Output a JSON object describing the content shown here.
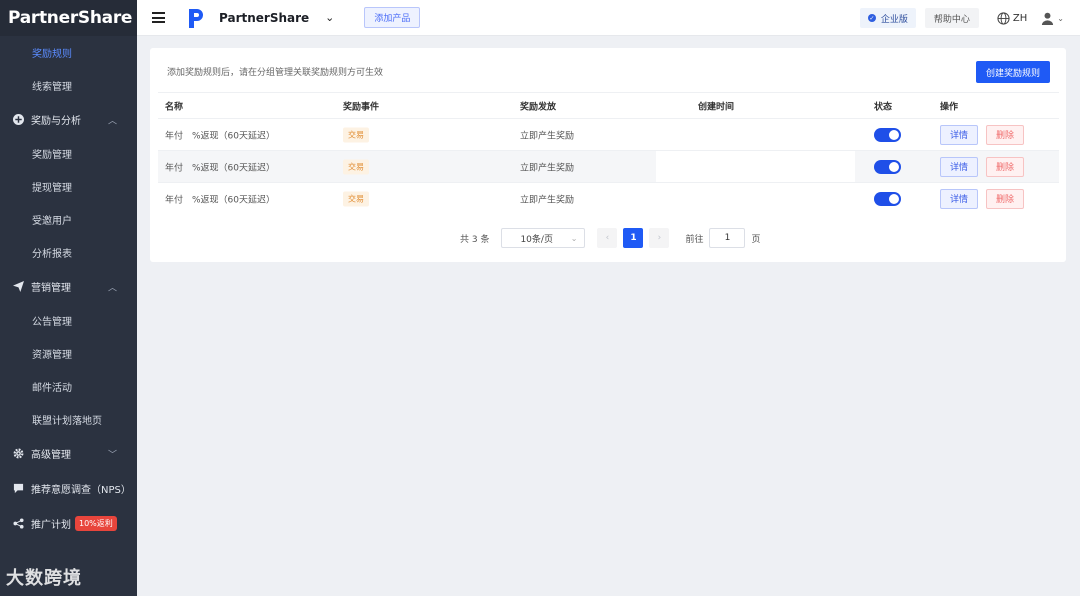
{
  "sidebar": {
    "logo": "PartnerShare",
    "top_items": [
      "奖励规则",
      "线索管理"
    ],
    "groups": [
      {
        "label": "奖励与分析",
        "icon": "plus-circle-icon",
        "chevron": "up",
        "items": [
          "奖励管理",
          "提现管理",
          "受邀用户",
          "分析报表"
        ]
      },
      {
        "label": "营销管理",
        "icon": "paper-plane-icon",
        "chevron": "up",
        "items": [
          "公告管理",
          "资源管理",
          "邮件活动",
          "联盟计划落地页"
        ]
      },
      {
        "label": "高级管理",
        "icon": "gear-icon",
        "chevron": "down",
        "items": []
      },
      {
        "label": "推荐意愿调查（NPS）",
        "icon": "chat-icon",
        "chevron": "",
        "items": []
      },
      {
        "label": "推广计划",
        "icon": "share-icon",
        "chevron": "",
        "items": [],
        "badge": "10%返利"
      }
    ],
    "watermark": "大数跨境",
    "active_item": "奖励规则"
  },
  "header": {
    "app_name": "PartnerShare",
    "add_product": "添加产品",
    "enterprise": "企业版",
    "help": "帮助中心",
    "lang": "ZH"
  },
  "main": {
    "hint": "添加奖励规则后，请在分组管理关联奖励规则方可生效",
    "create_button": "创建奖励规则",
    "columns": [
      "名称",
      "奖励事件",
      "奖励发放",
      "创建时间",
      "状态",
      "操作"
    ],
    "rows": [
      {
        "name": "年付　%返现（60天延迟）",
        "event": "交易",
        "issue": "立即产生奖励",
        "time": "",
        "enabled": true,
        "detail": "详情",
        "delete": "删除"
      },
      {
        "name": "年付　%返现（60天延迟）",
        "event": "交易",
        "issue": "立即产生奖励",
        "time": "",
        "enabled": true,
        "detail": "详情",
        "delete": "删除"
      },
      {
        "name": "年付　%返现（60天延迟）",
        "event": "交易",
        "issue": "立即产生奖励",
        "time": "",
        "enabled": true,
        "detail": "详情",
        "delete": "删除"
      }
    ],
    "pagination": {
      "total": "共 3 条",
      "page_size": "10条/页",
      "current": "1",
      "goto_label": "前往",
      "goto_value": "1",
      "page_suffix": "页"
    }
  },
  "colors": {
    "accent": "#1f5af5",
    "sidebar_bg": "#2b3240",
    "danger": "#f06b6b",
    "tag": "#e08a2e"
  }
}
